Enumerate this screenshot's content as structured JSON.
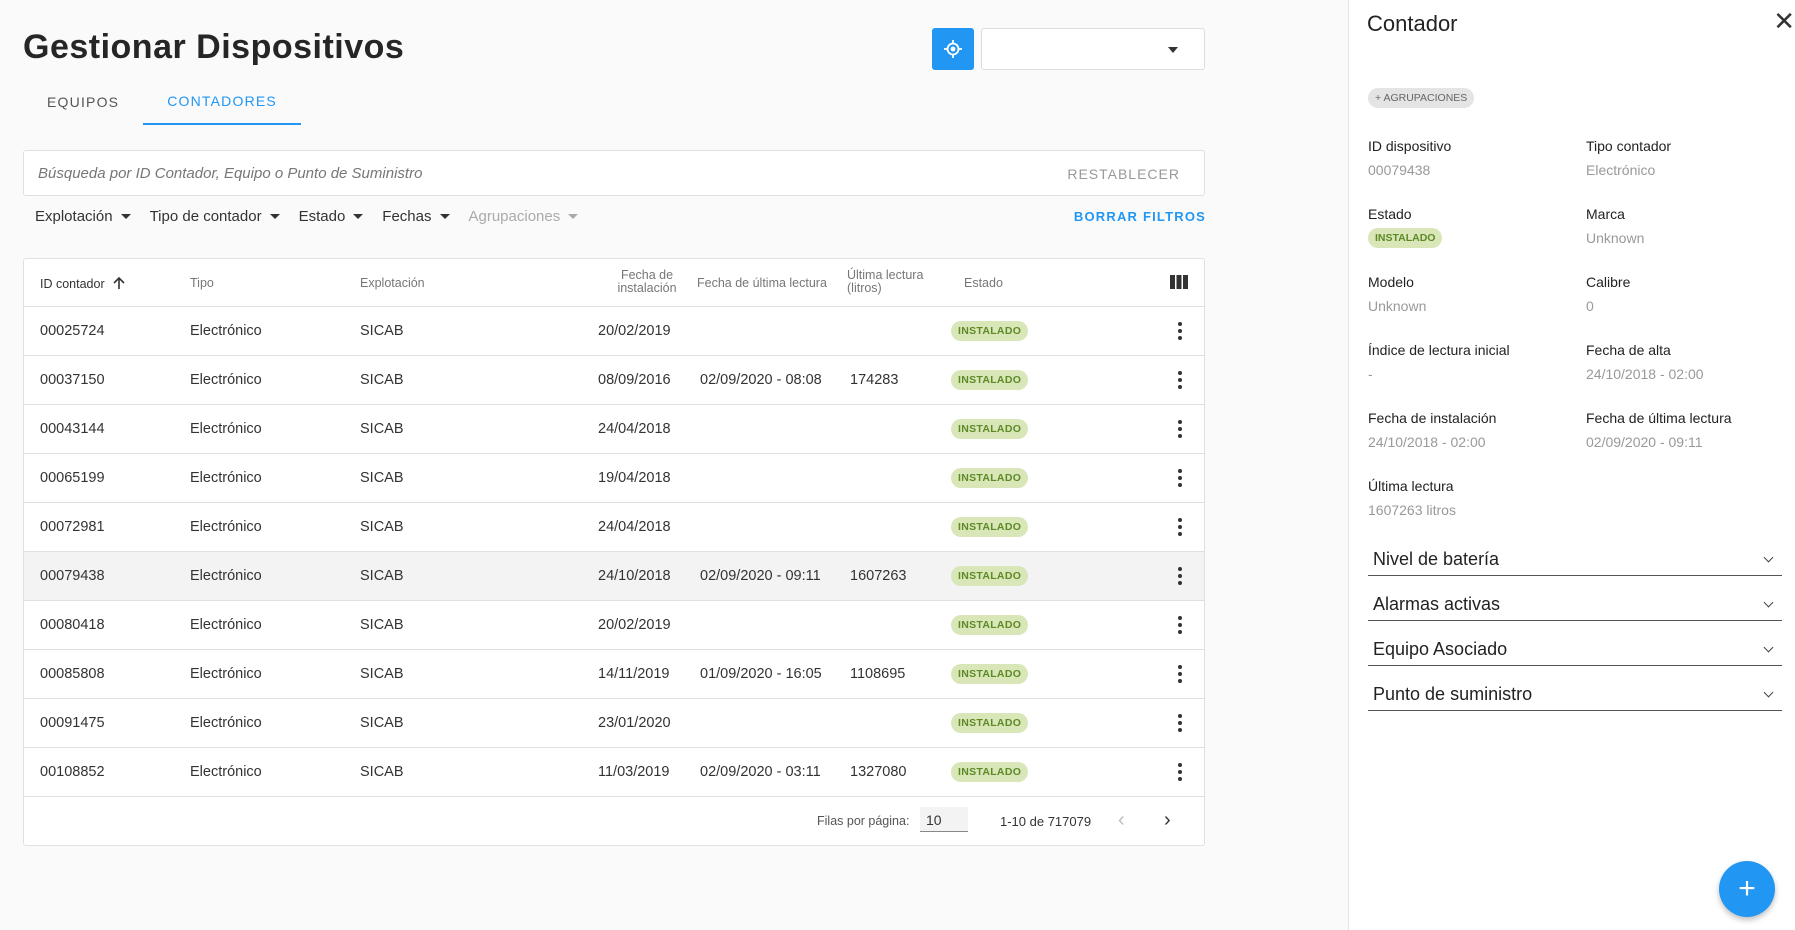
{
  "page": {
    "title": "Gestionar Dispositivos"
  },
  "header": {
    "locate_icon": "crosshair-icon",
    "select_value": ""
  },
  "tabs": [
    {
      "label": "EQUIPOS"
    },
    {
      "label": "CONTADORES",
      "active": true
    }
  ],
  "search": {
    "placeholder": "Búsqueda por ID Contador, Equipo o Punto de Suministro",
    "reset_label": "RESTABLECER"
  },
  "filters": {
    "explotacion": "Explotación",
    "tipo": "Tipo de contador",
    "estado": "Estado",
    "fechas": "Fechas",
    "agrupaciones": "Agrupaciones",
    "clear_label": "BORRAR FILTROS"
  },
  "table": {
    "headers": {
      "id": "ID contador",
      "tipo": "Tipo",
      "explotacion": "Explotación",
      "fecha_instalacion_1": "Fecha de",
      "fecha_instalacion_2": "instalación",
      "fecha_lectura": "Fecha de última lectura",
      "ultima_lectura_1": "Última lectura",
      "ultima_lectura_2": "(litros)",
      "estado": "Estado"
    },
    "rows": [
      {
        "id": "00025724",
        "tipo": "Electrónico",
        "explotacion": "SICAB",
        "fecha_instalacion": "20/02/2019",
        "fecha_lectura": "",
        "ultima_lectura": "",
        "estado": "INSTALADO"
      },
      {
        "id": "00037150",
        "tipo": "Electrónico",
        "explotacion": "SICAB",
        "fecha_instalacion": "08/09/2016",
        "fecha_lectura": "02/09/2020 - 08:08",
        "ultima_lectura": "174283",
        "estado": "INSTALADO"
      },
      {
        "id": "00043144",
        "tipo": "Electrónico",
        "explotacion": "SICAB",
        "fecha_instalacion": "24/04/2018",
        "fecha_lectura": "",
        "ultima_lectura": "",
        "estado": "INSTALADO"
      },
      {
        "id": "00065199",
        "tipo": "Electrónico",
        "explotacion": "SICAB",
        "fecha_instalacion": "19/04/2018",
        "fecha_lectura": "",
        "ultima_lectura": "",
        "estado": "INSTALADO"
      },
      {
        "id": "00072981",
        "tipo": "Electrónico",
        "explotacion": "SICAB",
        "fecha_instalacion": "24/04/2018",
        "fecha_lectura": "",
        "ultima_lectura": "",
        "estado": "INSTALADO"
      },
      {
        "id": "00079438",
        "tipo": "Electrónico",
        "explotacion": "SICAB",
        "fecha_instalacion": "24/10/2018",
        "fecha_lectura": "02/09/2020 - 09:11",
        "ultima_lectura": "1607263",
        "estado": "INSTALADO",
        "selected": true
      },
      {
        "id": "00080418",
        "tipo": "Electrónico",
        "explotacion": "SICAB",
        "fecha_instalacion": "20/02/2019",
        "fecha_lectura": "",
        "ultima_lectura": "",
        "estado": "INSTALADO"
      },
      {
        "id": "00085808",
        "tipo": "Electrónico",
        "explotacion": "SICAB",
        "fecha_instalacion": "14/11/2019",
        "fecha_lectura": "01/09/2020 - 16:05",
        "ultima_lectura": "1108695",
        "estado": "INSTALADO"
      },
      {
        "id": "00091475",
        "tipo": "Electrónico",
        "explotacion": "SICAB",
        "fecha_instalacion": "23/01/2020",
        "fecha_lectura": "",
        "ultima_lectura": "",
        "estado": "INSTALADO"
      },
      {
        "id": "00108852",
        "tipo": "Electrónico",
        "explotacion": "SICAB",
        "fecha_instalacion": "11/03/2019",
        "fecha_lectura": "02/09/2020 - 03:11",
        "ultima_lectura": "1327080",
        "estado": "INSTALADO"
      }
    ]
  },
  "pager": {
    "rows_label": "Filas por página:",
    "rows_value": "10",
    "range": "1-10 de 717079"
  },
  "panel": {
    "title": "Contador",
    "chip": "+ AGRUPACIONES",
    "fields": {
      "id_k": "ID dispositivo",
      "id_v": "00079438",
      "tipo_k": "Tipo contador",
      "tipo_v": "Electrónico",
      "estado_k": "Estado",
      "estado_v": "INSTALADO",
      "marca_k": "Marca",
      "marca_v": "Unknown",
      "modelo_k": "Modelo",
      "modelo_v": "Unknown",
      "calibre_k": "Calibre",
      "calibre_v": "0",
      "indice_k": "Índice de lectura inicial",
      "indice_v": "-",
      "alta_k": "Fecha de alta",
      "alta_v": "24/10/2018 - 02:00",
      "instal_k": "Fecha de instalación",
      "instal_v": "24/10/2018 - 02:00",
      "ult_fecha_k": "Fecha de última lectura",
      "ult_fecha_v": "02/09/2020 - 09:11",
      "ult_k": "Última lectura",
      "ult_v": "1607263 litros"
    },
    "accordions": [
      "Nivel de batería",
      "Alarmas activas",
      "Equipo Asociado",
      "Punto de suministro"
    ]
  },
  "fab": {
    "label": "+"
  },
  "colors": {
    "accent": "#2196f3",
    "badge_bg": "#d8e6b8",
    "badge_text": "#5e8a26"
  }
}
